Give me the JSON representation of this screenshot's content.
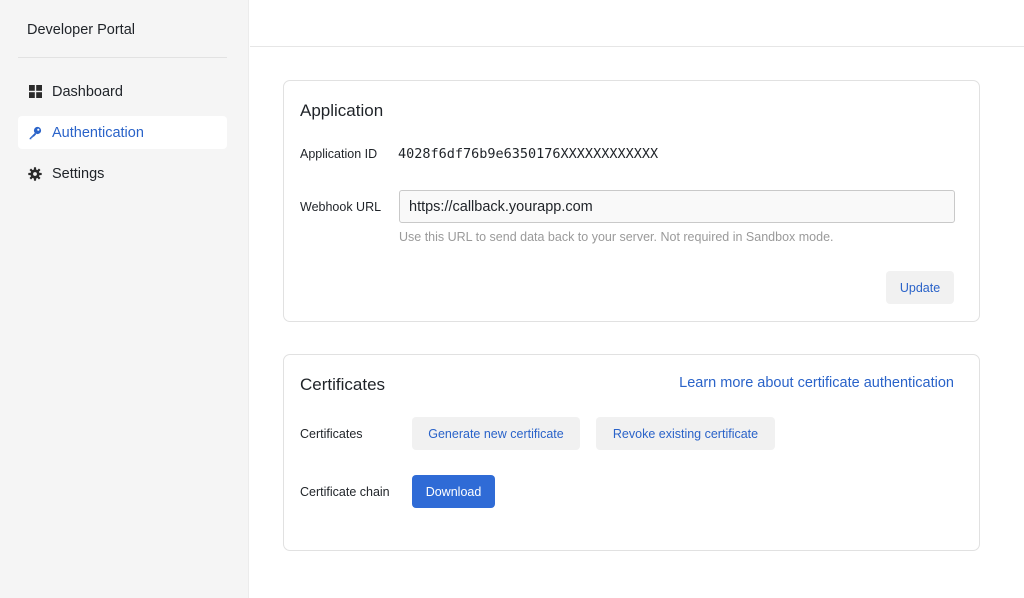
{
  "sidebar": {
    "brand": "Developer Portal",
    "items": [
      {
        "label": "Dashboard",
        "icon": "grid-icon",
        "active": false
      },
      {
        "label": "Authentication",
        "icon": "key-icon",
        "active": true
      },
      {
        "label": "Settings",
        "icon": "gear-icon",
        "active": false
      }
    ]
  },
  "application": {
    "title": "Application",
    "app_id_label": "Application ID",
    "app_id_value": "4028f6df76b9e6350176XXXXXXXXXXXX",
    "webhook_label": "Webhook URL",
    "webhook_value": "https://callback.yourapp.com",
    "webhook_helper": "Use this URL to send data back to your server. Not required in Sandbox mode.",
    "update_label": "Update"
  },
  "certificates": {
    "title": "Certificates",
    "learn_more_link": "Learn more about certificate authentication",
    "certificates_label": "Certificates",
    "generate_label": "Generate new certificate",
    "revoke_label": "Revoke existing certificate",
    "chain_label": "Certificate chain",
    "download_label": "Download"
  },
  "colors": {
    "accent": "#2a63c9",
    "primary_button": "#2f6bd6",
    "sidebar_bg": "#f5f5f5"
  }
}
